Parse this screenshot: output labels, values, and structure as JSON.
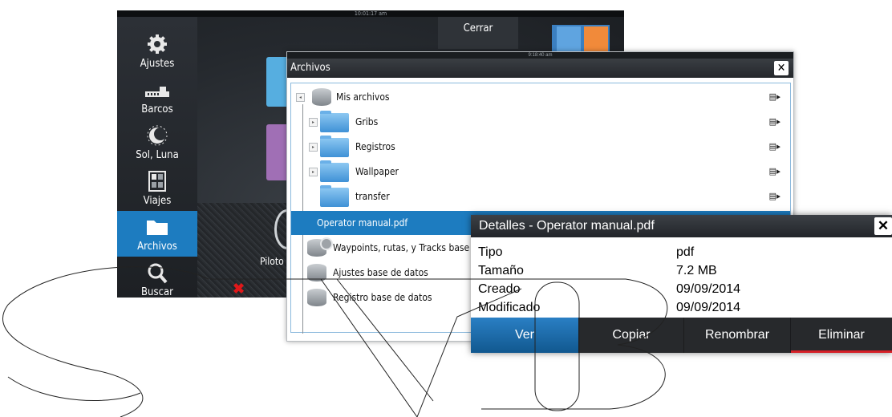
{
  "screen": {
    "clock": "10:01:17 am",
    "close_label": "Cerrar",
    "pilot_label": "Piloto",
    "sidebar": [
      {
        "label": "Ajustes",
        "icon": "gear-icon"
      },
      {
        "label": "Barcos",
        "icon": "ship-icon"
      },
      {
        "label": "Sol, Luna",
        "icon": "sun-moon-icon"
      },
      {
        "label": "Viajes",
        "icon": "trip-calculator-icon"
      },
      {
        "label": "Archivos",
        "icon": "folder-icon",
        "active": true
      },
      {
        "label": "Buscar",
        "icon": "search-icon"
      }
    ]
  },
  "files": {
    "clock": "9:18:40 am",
    "title": "Archivos",
    "items": [
      {
        "label": "Mis archivos",
        "icon": "database-icon"
      },
      {
        "label": "Gribs",
        "icon": "folder-icon"
      },
      {
        "label": "Registros",
        "icon": "folder-icon"
      },
      {
        "label": "Wallpaper",
        "icon": "folder-icon"
      },
      {
        "label": "transfer",
        "icon": "folder-icon"
      },
      {
        "label": "Operator manual.pdf",
        "selected": true
      },
      {
        "label": "Waypoints, rutas, y Tracks base de datos",
        "icon": "database-icon"
      },
      {
        "label": "Ajustes base de datos",
        "icon": "database-gear-icon"
      },
      {
        "label": "Registro base de datos",
        "icon": "database-icon"
      }
    ]
  },
  "details": {
    "title": "Detalles - Operator manual.pdf",
    "fields": [
      {
        "label": "Tipo",
        "value": "pdf"
      },
      {
        "label": "Tamaño",
        "value": "7.2 MB"
      },
      {
        "label": "Creado",
        "value": "09/09/2014"
      },
      {
        "label": "Modificado",
        "value": "09/09/2014"
      }
    ],
    "buttons": [
      "Ver",
      "Copiar",
      "Renombrar",
      "Eliminar"
    ]
  },
  "colors": {
    "accent": "#1d7cc0",
    "danger": "#d51f26"
  }
}
